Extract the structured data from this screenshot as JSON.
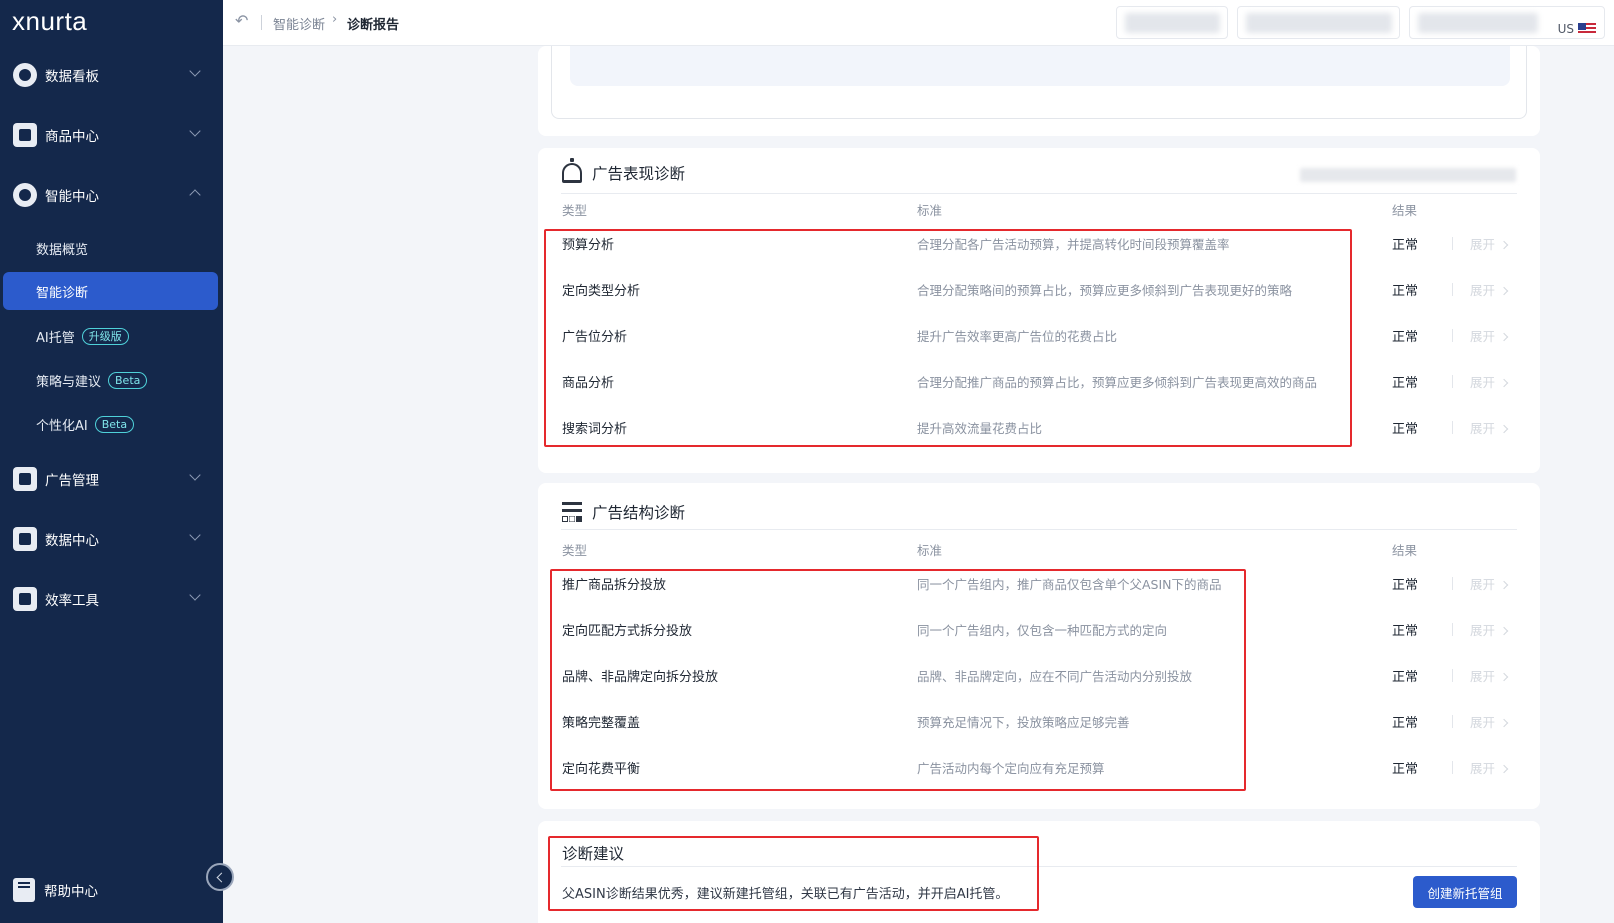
{
  "app": {
    "logo": "xnurta"
  },
  "sidebar": {
    "groups": [
      {
        "label": "数据看板",
        "icon": "gauge-icon"
      },
      {
        "label": "商品中心",
        "icon": "cubes-icon"
      },
      {
        "label": "智能中心",
        "icon": "brain-icon"
      }
    ],
    "sub_items": [
      {
        "label": "数据概览"
      },
      {
        "label": "智能诊断",
        "active": true
      },
      {
        "label": "AI托管",
        "tag": "升级版"
      },
      {
        "label": "策略与建议",
        "tag": "Beta"
      },
      {
        "label": "个性化AI",
        "tag": "Beta"
      }
    ],
    "groups2": [
      {
        "label": "广告管理",
        "icon": "ads-icon"
      },
      {
        "label": "数据中心",
        "icon": "chart-icon"
      },
      {
        "label": "效率工具",
        "icon": "toolbox-icon"
      }
    ],
    "help": {
      "label": "帮助中心"
    }
  },
  "header": {
    "breadcrumb": [
      "智能诊断",
      "诊断报告"
    ],
    "region": "US"
  },
  "perf_section": {
    "title": "广告表现诊断",
    "columns": {
      "type": "类型",
      "standard": "标准",
      "result": "结果"
    },
    "expand_label": "展开",
    "rows": [
      {
        "type": "预算分析",
        "standard": "合理分配各广告活动预算，并提高转化时间段预算覆盖率",
        "result": "正常"
      },
      {
        "type": "定向类型分析",
        "standard": "合理分配策略间的预算占比，预算应更多倾斜到广告表现更好的策略",
        "result": "正常"
      },
      {
        "type": "广告位分析",
        "standard": "提升广告效率更高广告位的花费占比",
        "result": "正常"
      },
      {
        "type": "商品分析",
        "standard": "合理分配推广商品的预算占比，预算应更多倾斜到广告表现更高效的商品",
        "result": "正常"
      },
      {
        "type": "搜索词分析",
        "standard": "提升高效流量花费占比",
        "result": "正常"
      }
    ]
  },
  "struct_section": {
    "title": "广告结构诊断",
    "columns": {
      "type": "类型",
      "standard": "标准",
      "result": "结果"
    },
    "expand_label": "展开",
    "rows": [
      {
        "type": "推广商品拆分投放",
        "standard": "同一个广告组内，推广商品仅包含单个父ASIN下的商品",
        "result": "正常"
      },
      {
        "type": "定向匹配方式拆分投放",
        "standard": "同一个广告组内，仅包含一种匹配方式的定向",
        "result": "正常"
      },
      {
        "type": "品牌、非品牌定向拆分投放",
        "standard": "品牌、非品牌定向，应在不同广告活动内分别投放",
        "result": "正常"
      },
      {
        "type": "策略完整覆盖",
        "standard": "预算充足情况下，投放策略应足够完善",
        "result": "正常"
      },
      {
        "type": "定向花费平衡",
        "standard": "广告活动内每个定向应有充足预算",
        "result": "正常"
      }
    ]
  },
  "suggestion": {
    "title": "诊断建议",
    "text": "父ASIN诊断结果优秀，建议新建托管组，关联已有广告活动，并开启AI托管。",
    "button_label": "创建新托管组"
  }
}
